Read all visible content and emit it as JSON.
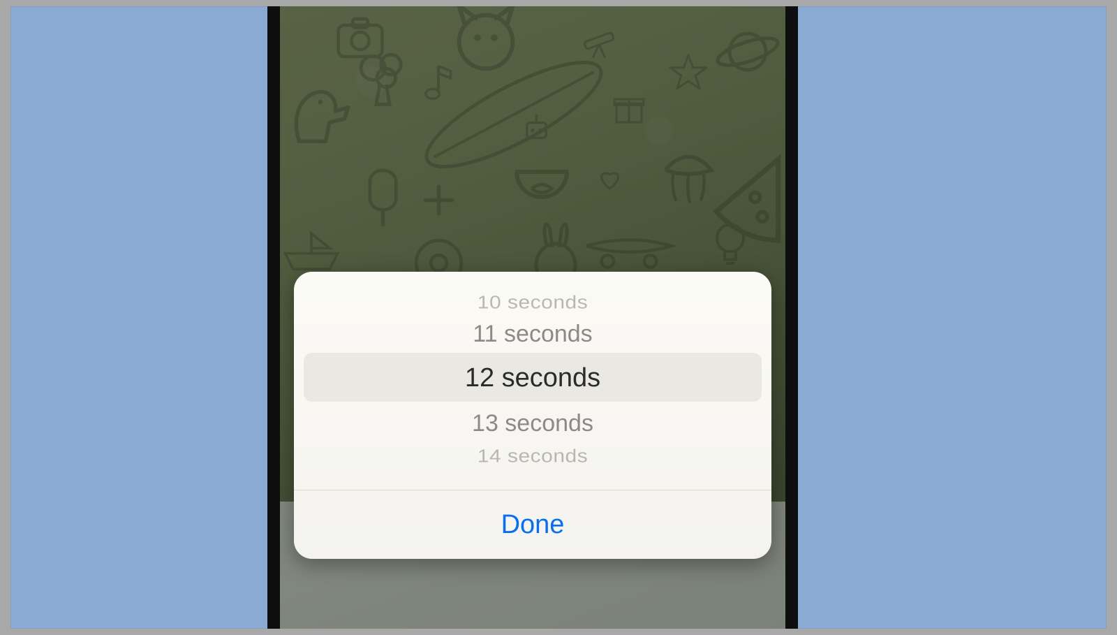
{
  "picker": {
    "options": {
      "o0": "10 seconds",
      "o1": "11 seconds",
      "o2": "12 seconds",
      "o3": "13 seconds",
      "o4": "14 seconds"
    },
    "selected_index": 2
  },
  "actions": {
    "done_label": "Done"
  },
  "colors": {
    "accent": "#0a6ef0",
    "sheet_bg": "#f6f5f0",
    "selection_band": "#e9e8e3",
    "wallpaper_tint": "#7f8f63"
  }
}
